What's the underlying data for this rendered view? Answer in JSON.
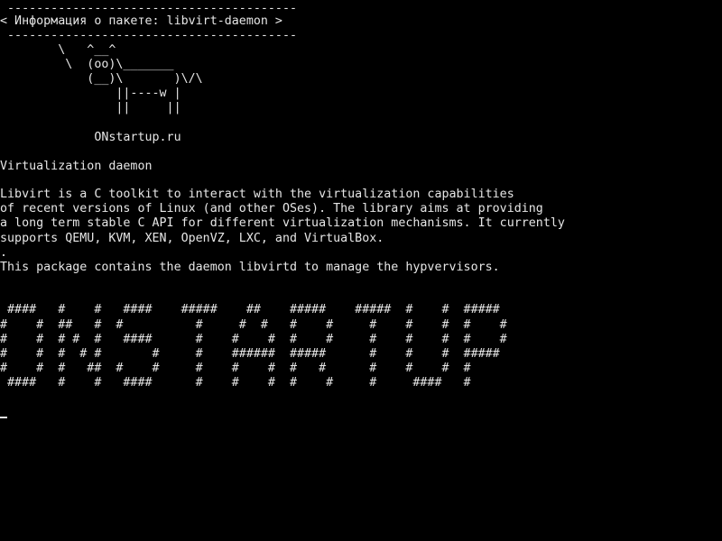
{
  "terminal": {
    "cowsay": {
      "border_top": " ----------------------------------------",
      "message": "< Информация о пакете: libvirt-daemon >",
      "border_bottom": " ----------------------------------------",
      "cow": [
        "        \\   ^__^",
        "         \\  (oo)\\_______",
        "            (__)\\       )\\/\\",
        "                ||----w |",
        "                ||     ||"
      ]
    },
    "site": "             ONstartup.ru",
    "summary": "Virtualization daemon",
    "description": [
      "Libvirt is a C toolkit to interact with the virtualization capabilities",
      "of recent versions of Linux (and other OSes). The library aims at providing",
      "a long term stable C API for different virtualization mechanisms. It currently",
      "supports QEMU, KVM, XEN, OpenVZ, LXC, and VirtualBox.",
      ".",
      "This package contains the daemon libvirtd to manage the hypvervisors."
    ],
    "banner": [
      " ####   #    #   ####    #####    ##    #####    #####  #    #  #####",
      "#    #  ##   #  #          #     #  #   #    #     #    #    #  #    #",
      "#    #  # #  #   ####      #    #    #  #    #     #    #    #  #    #",
      "#    #  #  # #       #     #    ######  #####      #    #    #  #####",
      "#    #  #   ##  #    #     #    #    #  #   #      #    #    #  #",
      " ####   #    #   ####      #    #    #  #    #     #     ####   #"
    ]
  }
}
